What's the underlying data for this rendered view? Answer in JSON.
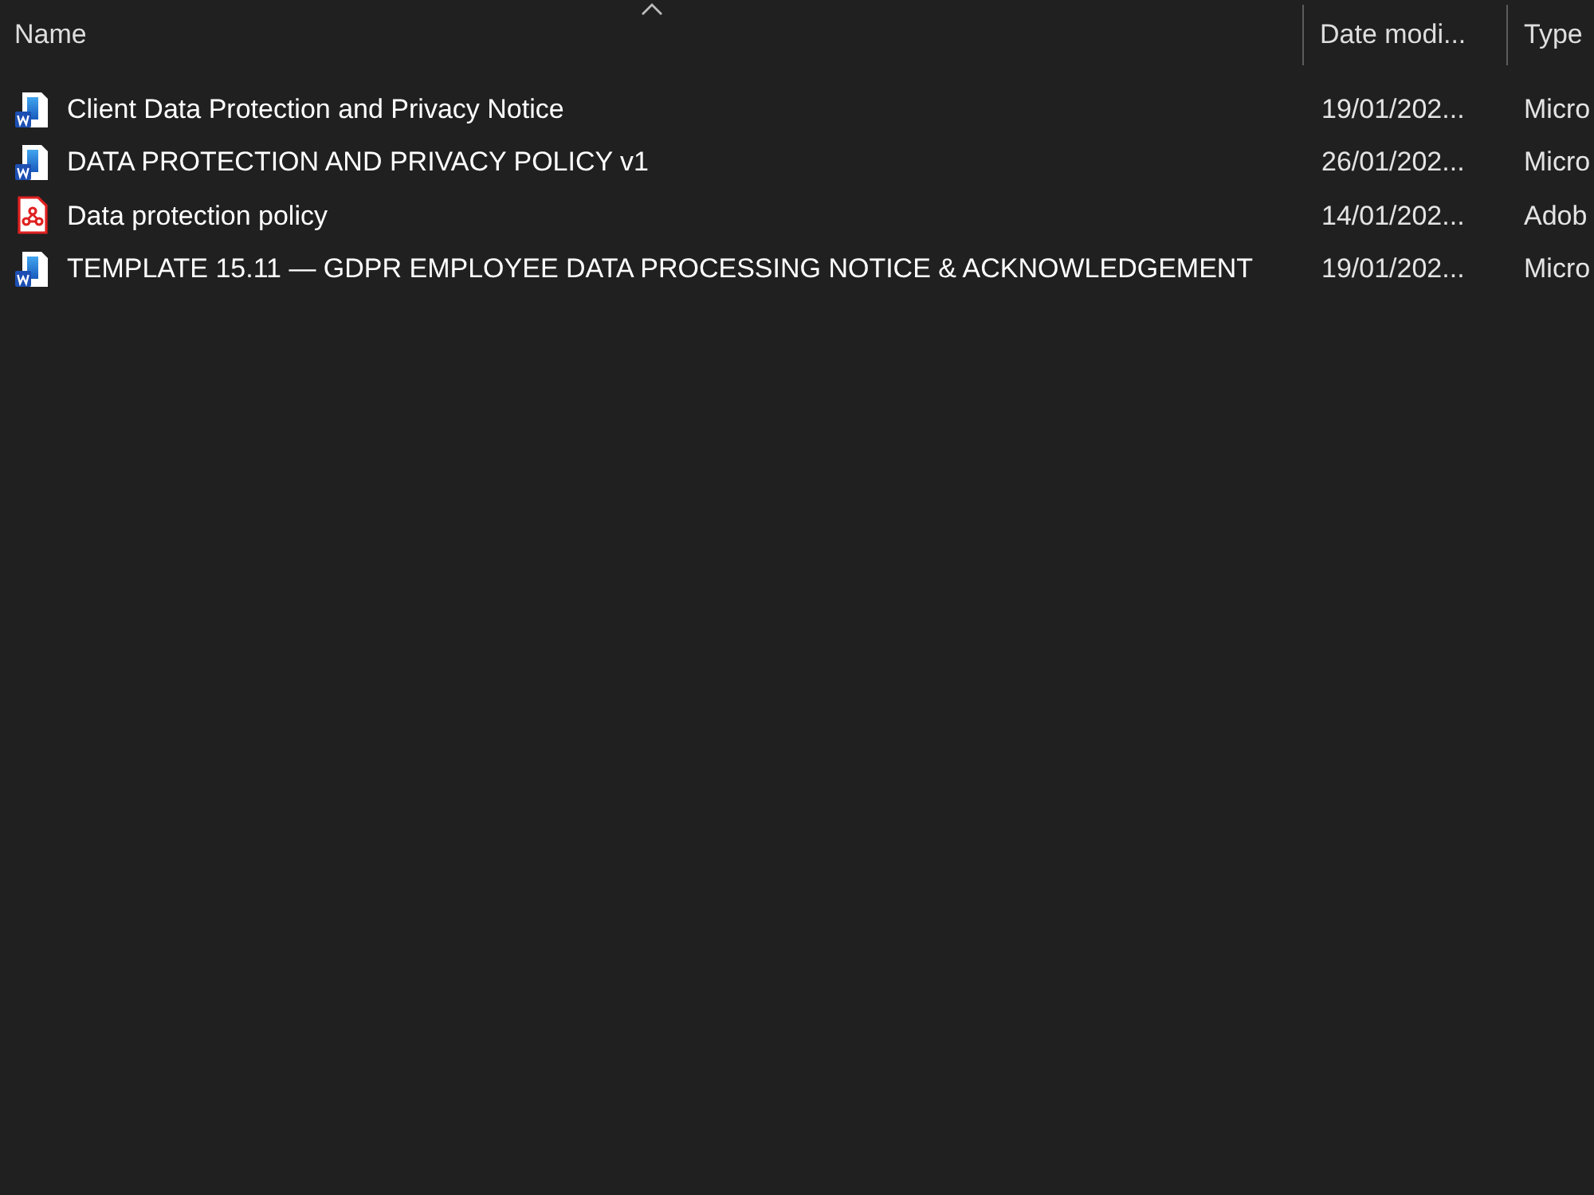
{
  "columns": [
    {
      "label": "Name",
      "sorted": true
    },
    {
      "label": "Date modi...",
      "sorted": false
    },
    {
      "label": "Type",
      "sorted": false
    }
  ],
  "files": [
    {
      "kind": "word",
      "name": "Client Data Protection and Privacy Notice",
      "date_modified": "19/01/202...",
      "type": "Micro"
    },
    {
      "kind": "word",
      "name": "DATA PROTECTION AND PRIVACY POLICY v1",
      "date_modified": "26/01/202...",
      "type": "Micro"
    },
    {
      "kind": "pdf",
      "name": "Data protection policy",
      "date_modified": "14/01/202...",
      "type": "Adob"
    },
    {
      "kind": "word",
      "name": "TEMPLATE 15.11 — GDPR EMPLOYEE DATA PROCESSING NOTICE & ACKNOWLEDGEMENT",
      "date_modified": "19/01/202...",
      "type": "Micro"
    }
  ]
}
